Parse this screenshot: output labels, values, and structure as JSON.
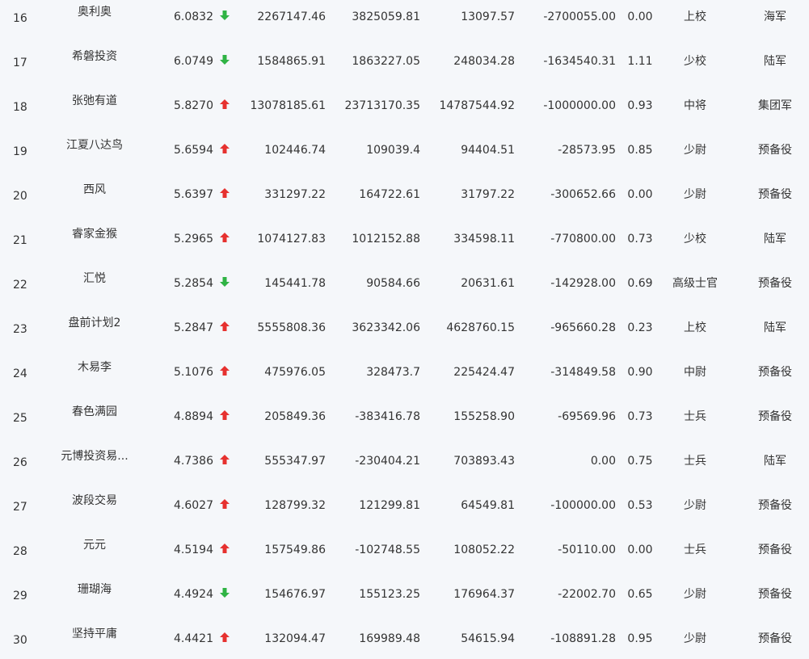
{
  "colors": {
    "background": "#f5f7fa",
    "text": "#333333",
    "up_arrow": "#e6312f",
    "down_arrow": "#2fb344"
  },
  "rows": [
    {
      "rank": "16",
      "name": "奥利奥",
      "score": "6.0832",
      "trend": "down",
      "v1": "2267147.46",
      "v2": "3825059.81",
      "v3": "13097.57",
      "v4": "-2700055.00",
      "ratio": "0.00",
      "title": "上校",
      "branch": "海军"
    },
    {
      "rank": "17",
      "name": "希磐投资",
      "score": "6.0749",
      "trend": "down",
      "v1": "1584865.91",
      "v2": "1863227.05",
      "v3": "248034.28",
      "v4": "-1634540.31",
      "ratio": "1.11",
      "title": "少校",
      "branch": "陆军"
    },
    {
      "rank": "18",
      "name": "张弛有道",
      "score": "5.8270",
      "trend": "up",
      "v1": "13078185.61",
      "v2": "23713170.35",
      "v3": "14787544.92",
      "v4": "-1000000.00",
      "ratio": "0.93",
      "title": "中将",
      "branch": "集团军"
    },
    {
      "rank": "19",
      "name": "江夏八达鸟",
      "score": "5.6594",
      "trend": "up",
      "v1": "102446.74",
      "v2": "109039.4",
      "v3": "94404.51",
      "v4": "-28573.95",
      "ratio": "0.85",
      "title": "少尉",
      "branch": "预备役"
    },
    {
      "rank": "20",
      "name": "西风",
      "score": "5.6397",
      "trend": "up",
      "v1": "331297.22",
      "v2": "164722.61",
      "v3": "31797.22",
      "v4": "-300652.66",
      "ratio": "0.00",
      "title": "少尉",
      "branch": "预备役"
    },
    {
      "rank": "21",
      "name": "睿家金猴",
      "score": "5.2965",
      "trend": "up",
      "v1": "1074127.83",
      "v2": "1012152.88",
      "v3": "334598.11",
      "v4": "-770800.00",
      "ratio": "0.73",
      "title": "少校",
      "branch": "陆军"
    },
    {
      "rank": "22",
      "name": "汇悦",
      "score": "5.2854",
      "trend": "down",
      "v1": "145441.78",
      "v2": "90584.66",
      "v3": "20631.61",
      "v4": "-142928.00",
      "ratio": "0.69",
      "title": "高级士官",
      "branch": "预备役"
    },
    {
      "rank": "23",
      "name": "盘前计划2",
      "score": "5.2847",
      "trend": "up",
      "v1": "5555808.36",
      "v2": "3623342.06",
      "v3": "4628760.15",
      "v4": "-965660.28",
      "ratio": "0.23",
      "title": "上校",
      "branch": "陆军"
    },
    {
      "rank": "24",
      "name": "木易李",
      "score": "5.1076",
      "trend": "up",
      "v1": "475976.05",
      "v2": "328473.7",
      "v3": "225424.47",
      "v4": "-314849.58",
      "ratio": "0.90",
      "title": "中尉",
      "branch": "预备役"
    },
    {
      "rank": "25",
      "name": "春色满园",
      "score": "4.8894",
      "trend": "up",
      "v1": "205849.36",
      "v2": "-383416.78",
      "v3": "155258.90",
      "v4": "-69569.96",
      "ratio": "0.73",
      "title": "士兵",
      "branch": "预备役"
    },
    {
      "rank": "26",
      "name": "元博投资易...",
      "score": "4.7386",
      "trend": "up",
      "v1": "555347.97",
      "v2": "-230404.21",
      "v3": "703893.43",
      "v4": "0.00",
      "ratio": "0.75",
      "title": "士兵",
      "branch": "陆军"
    },
    {
      "rank": "27",
      "name": "波段交易",
      "score": "4.6027",
      "trend": "up",
      "v1": "128799.32",
      "v2": "121299.81",
      "v3": "64549.81",
      "v4": "-100000.00",
      "ratio": "0.53",
      "title": "少尉",
      "branch": "预备役"
    },
    {
      "rank": "28",
      "name": "元元",
      "score": "4.5194",
      "trend": "up",
      "v1": "157549.86",
      "v2": "-102748.55",
      "v3": "108052.22",
      "v4": "-50110.00",
      "ratio": "0.00",
      "title": "士兵",
      "branch": "预备役"
    },
    {
      "rank": "29",
      "name": "珊瑚海",
      "score": "4.4924",
      "trend": "down",
      "v1": "154676.97",
      "v2": "155123.25",
      "v3": "176964.37",
      "v4": "-22002.70",
      "ratio": "0.65",
      "title": "少尉",
      "branch": "预备役"
    },
    {
      "rank": "30",
      "name": "坚持平庸",
      "score": "4.4421",
      "trend": "up",
      "v1": "132094.47",
      "v2": "169989.48",
      "v3": "54615.94",
      "v4": "-108891.28",
      "ratio": "0.95",
      "title": "少尉",
      "branch": "预备役"
    }
  ]
}
